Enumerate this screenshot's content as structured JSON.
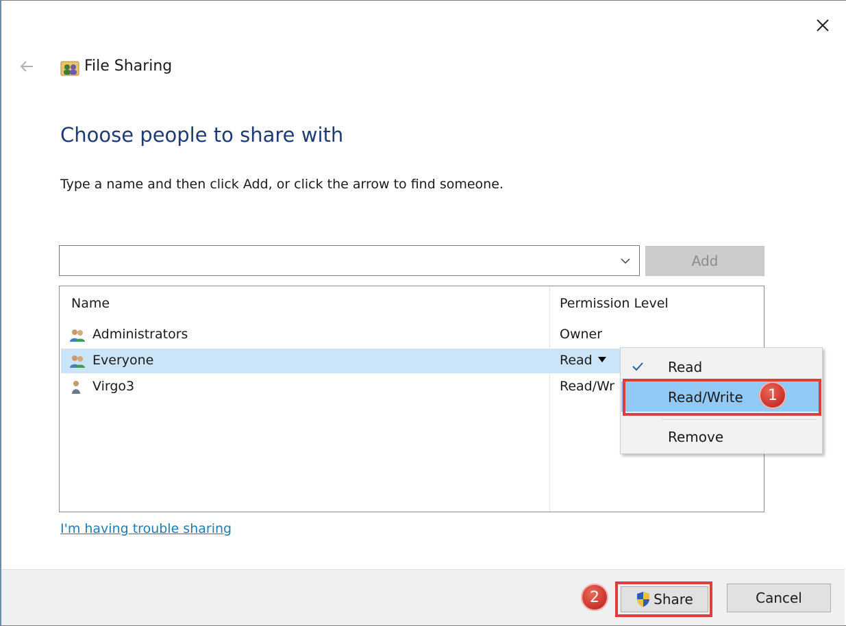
{
  "window": {
    "title": "File Sharing",
    "heading": "Choose people to share with",
    "instruction": "Type a name and then click Add, or click the arrow to find someone."
  },
  "name_input": {
    "value": "",
    "placeholder": ""
  },
  "add_button": {
    "label": "Add"
  },
  "list": {
    "headers": {
      "name": "Name",
      "permission": "Permission Level"
    },
    "rows": [
      {
        "name": "Administrators",
        "permission": "Owner",
        "icon": "user-group-icon"
      },
      {
        "name": "Everyone",
        "permission": "Read",
        "icon": "user-group-icon"
      },
      {
        "name": "Virgo3",
        "permission": "Read/Write",
        "icon": "user-icon"
      }
    ]
  },
  "permission_menu": {
    "items": [
      {
        "label": "Read",
        "checked": true
      },
      {
        "label": "Read/Write",
        "checked": false
      },
      {
        "label": "Remove",
        "checked": false
      }
    ]
  },
  "annotations": {
    "step1": "1",
    "step2": "2"
  },
  "help_link": "I'm having trouble sharing",
  "footer": {
    "share_label": "Share",
    "cancel_label": "Cancel"
  },
  "colors": {
    "heading": "#1f3b74",
    "link": "#1f7bb0",
    "selected_row": "#cce4f7",
    "menu_hover": "#91c9f7",
    "annotation": "#d9403b"
  }
}
